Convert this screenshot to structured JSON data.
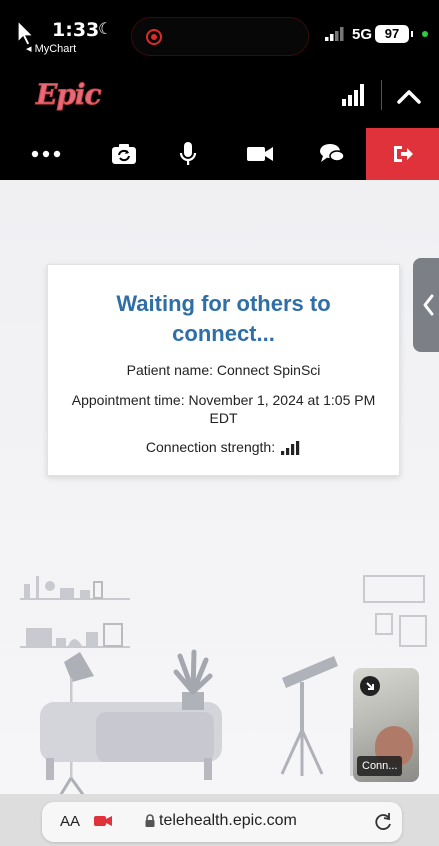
{
  "status_bar": {
    "time": "1:33",
    "back_app": "MyChart",
    "network": "5G",
    "battery": "97"
  },
  "header": {
    "logo": "Epic",
    "icons": [
      "signal-bars-icon",
      "chevron-up-icon"
    ]
  },
  "toolbar": {
    "buttons": [
      "more-icon",
      "switch-camera-icon",
      "microphone-icon",
      "video-camera-icon",
      "chat-icon",
      "leave-icon"
    ],
    "leave_color": "#e0323a"
  },
  "waiting_card": {
    "title": "Waiting for others to connect...",
    "patient": "Patient name: Connect SpinSci",
    "appointment": "Appointment time: November 1, 2024 at 1:05 PM EDT",
    "strength_label": "Connection strength:"
  },
  "self_view": {
    "label": "Conn..."
  },
  "url_bar": {
    "aa": "AA",
    "url": "telehealth.epic.com"
  },
  "colors": {
    "title_blue": "#2f6fa6",
    "logo_pink": "#e8697b"
  }
}
